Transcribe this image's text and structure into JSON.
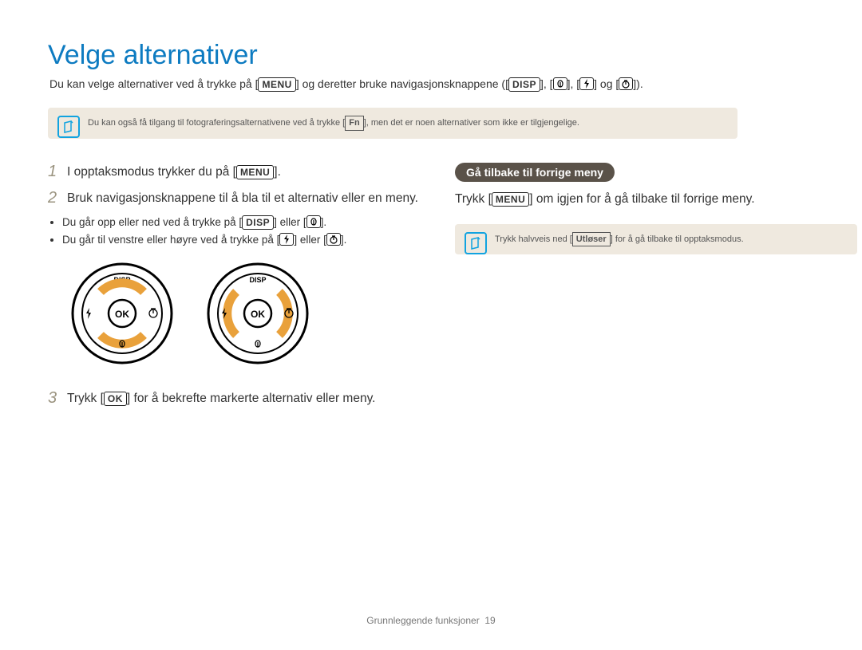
{
  "title": "Velge alternativer",
  "intro": {
    "part1": "Du kan velge alternativer ved å trykke på [",
    "menu": "MENU",
    "part2": "] og deretter bruke navigasjonsknappene ([",
    "disp": "DISP",
    "part3": "], [",
    "part4": "], [",
    "part5": "] og [",
    "part6": "])."
  },
  "note1": {
    "part_a": "Du kan også få tilgang til fotograferingsalternativene ved å trykke [",
    "fn": "Fn",
    "part_b": "], men det er noen alternativer som ikke er tilgjengelige."
  },
  "left": {
    "step1": {
      "num": "1",
      "text_a": "I opptaksmodus trykker du på [",
      "menu": "MENU",
      "text_b": "]."
    },
    "step2": {
      "num": "2",
      "text": "Bruk navigasjonsknappene til å bla til et alternativ eller en meny."
    },
    "bullet1": {
      "a": "Du går opp eller ned ved å trykke på [",
      "disp": "DISP",
      "b": "] eller [",
      "c": "]."
    },
    "bullet2": {
      "a": "Du går til venstre eller høyre ved å trykke på [",
      "b": "] eller [",
      "c": "]."
    },
    "dial_disp": "DISP",
    "dial_ok": "OK",
    "step3": {
      "num": "3",
      "a": "Trykk [",
      "ok": "OK",
      "b": "] for å bekrefte markerte alternativ eller meny."
    }
  },
  "right": {
    "pill": "Gå tilbake til forrige meny",
    "line": {
      "a": "Trykk [",
      "menu": "MENU",
      "b": "] om igjen for å gå tilbake til forrige meny."
    },
    "note": {
      "a": "Trykk halvveis ned [",
      "shutter": "Utløser",
      "b": "] for å gå tilbake til opptaksmodus."
    }
  },
  "footer": {
    "section": "Grunnleggende funksjoner",
    "page": "19"
  }
}
